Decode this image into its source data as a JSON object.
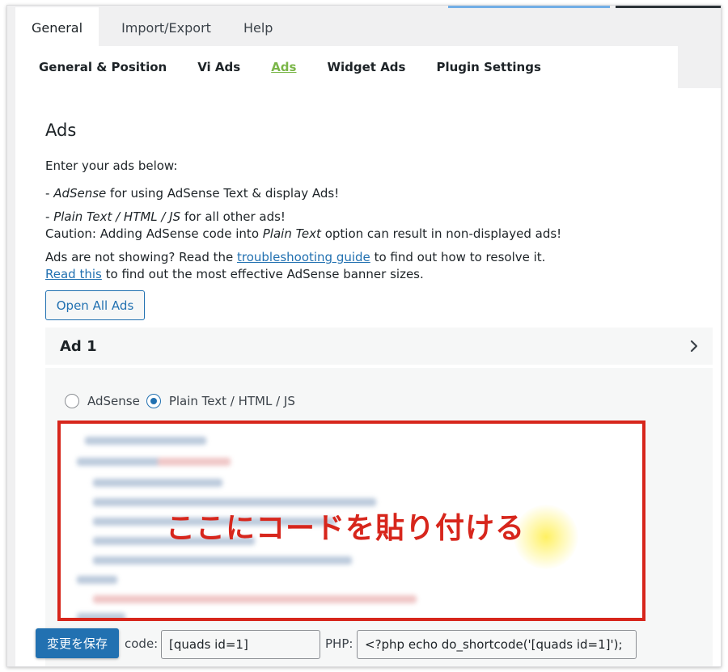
{
  "main_tabs": [
    {
      "label": "General",
      "active": true
    },
    {
      "label": "Import/Export",
      "active": false
    },
    {
      "label": "Help",
      "active": false
    }
  ],
  "sub_tabs": [
    {
      "label": "General & Position",
      "active": false
    },
    {
      "label": "Vi Ads",
      "active": false
    },
    {
      "label": "Ads",
      "active": true
    },
    {
      "label": "Widget Ads",
      "active": false
    },
    {
      "label": "Plugin Settings",
      "active": false
    }
  ],
  "section": {
    "title": "Ads",
    "intro": "Enter your ads below:",
    "adsense_prefix": "- ",
    "adsense_name": "AdSense",
    "adsense_suffix": " for using AdSense Text & display Ads!",
    "plain_prefix": "- ",
    "plain_name": "Plain Text / HTML / JS",
    "plain_suffix": " for all other ads!",
    "caution_prefix": "Caution: Adding AdSense code into ",
    "caution_name": "Plain Text",
    "caution_suffix": " option can result in non-displayed ads!",
    "help1_prefix": "Ads are not showing? Read the ",
    "help1_link": "troubleshooting guide",
    "help1_suffix": " to find out how to resolve it.",
    "help2_link": "Read this",
    "help2_suffix": " to find out the most effective AdSense banner sizes."
  },
  "open_all_button": "Open All Ads",
  "ad": {
    "title": "Ad 1",
    "chevron_icon": "chevron-right-icon",
    "radio_options": [
      {
        "label": "AdSense",
        "checked": false
      },
      {
        "label": "Plain Text / HTML / JS",
        "checked": true
      }
    ],
    "code_overlay": "ここにコードを貼り付ける",
    "shortcode_label": "code:",
    "shortcode_value": "[quads id=1]",
    "php_label": "PHP:",
    "php_value": "<?php echo do_shortcode('[quads id=1]');"
  },
  "save_button": "変更を保存",
  "colors": {
    "accent": "#2271b1",
    "active_subtab": "#7ab648",
    "highlight_border": "#d7261c",
    "overlay_text": "#d7261c"
  }
}
